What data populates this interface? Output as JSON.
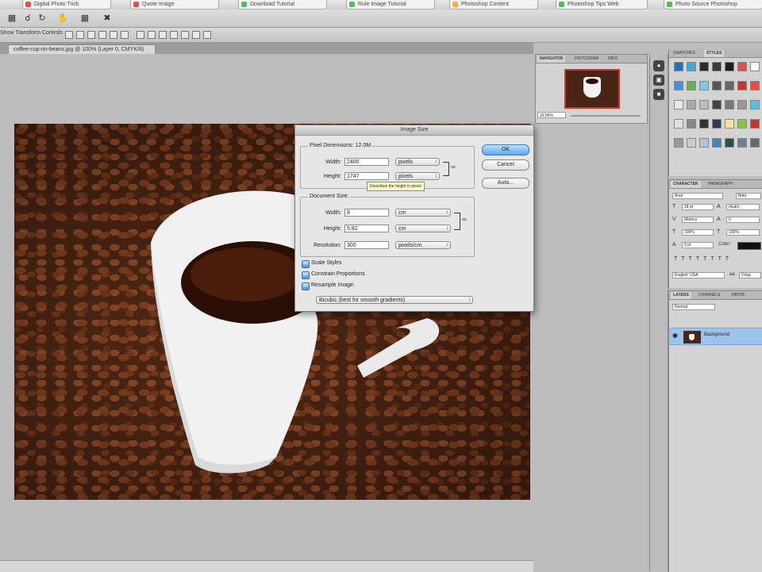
{
  "browser_tabs": [
    {
      "label": "Digital Photo Trick",
      "color": "#d9534f"
    },
    {
      "label": "Quote Image",
      "color": "#d9534f"
    },
    {
      "label": "Download Tutorial",
      "color": "#5cb85c"
    },
    {
      "label": "Rule Image Tutorial",
      "color": "#5cb85c"
    },
    {
      "label": "Photoshop Content",
      "color": "#f0ad4e"
    },
    {
      "label": "Photoshop Tips Web",
      "color": "#5cb85c"
    },
    {
      "label": "Photo Source Photoshop",
      "color": "#5cb85c"
    }
  ],
  "options_bar": {
    "label": "Show Transform Controls"
  },
  "document": {
    "tab_label": "coffee-cup-on-beans.jpg @ 100% (Layer 0, CMYK/8)"
  },
  "dialog": {
    "title": "Image Size",
    "pixel_dimensions": {
      "title": "Pixel Dimensions:",
      "size": "12.0M",
      "width_label": "Width:",
      "width_value": "2400",
      "width_unit": "pixels",
      "height_label": "Height:",
      "height_value": "1747",
      "height_unit": "pixels"
    },
    "tooltip": "Describes the height in pixels",
    "document_size": {
      "title": "Document Size:",
      "width_label": "Width:",
      "width_value": "8",
      "width_unit": "cm",
      "height_label": "Height:",
      "height_value": "5.82",
      "height_unit": "cm",
      "resolution_label": "Resolution:",
      "resolution_value": "300",
      "resolution_unit": "pixels/cm"
    },
    "checkboxes": [
      {
        "label": "Scale Styles",
        "checked": true
      },
      {
        "label": "Constrain Proportions",
        "checked": true
      },
      {
        "label": "Resample Image:",
        "checked": true
      }
    ],
    "resample_method": "Bicubic (best for smooth gradients)",
    "buttons": {
      "ok": "OK",
      "cancel": "Cancel",
      "auto": "Auto..."
    }
  },
  "navigator": {
    "tabs": [
      "NAVIGATOR",
      "HISTOGRAM",
      "INFO"
    ],
    "zoom": "16.66%"
  },
  "styles_panel": {
    "tabs": [
      "SWATCHES",
      "STYLES"
    ],
    "swatches": [
      "#2a6fb5",
      "#4aa3df",
      "#2b2b2b",
      "#3a3a3a",
      "#1e1e1e",
      "#d9534f",
      "#f5f5f5",
      "#4a90d9",
      "#6ab04c",
      "#7ec8e3",
      "#555555",
      "#666666",
      "#c0392b",
      "#e74c3c",
      "#e8e8e8",
      "#aaaaaa",
      "#bdbdbd",
      "#444444",
      "#777777",
      "#999999",
      "#5bc0de",
      "#e0e0e0",
      "#888888",
      "#333333",
      "#2c3e50",
      "#f0e68c",
      "#8bc34a",
      "#c0392b",
      "#999999",
      "#cccccc",
      "#b0c4de",
      "#4682b4",
      "#2f4f4f",
      "#708090",
      "#696969"
    ]
  },
  "character_panel": {
    "tabs": [
      "CHARACTER",
      "PARAGRAPH"
    ],
    "font_family": "Arial",
    "font_style": "Bold",
    "font_size": "18 pt",
    "leading": "(Auto)",
    "kerning": "Metrics",
    "tracking": "0",
    "vscale": "100%",
    "hscale": "100%",
    "baseline": "0 pt",
    "color_label": "Color:",
    "language": "English: USA",
    "antialias": "Crisp"
  },
  "layers_panel": {
    "tabs": [
      "LAYERS",
      "CHANNELS",
      "PATHS"
    ],
    "blend_mode": "Normal",
    "layer_name": "Background"
  }
}
